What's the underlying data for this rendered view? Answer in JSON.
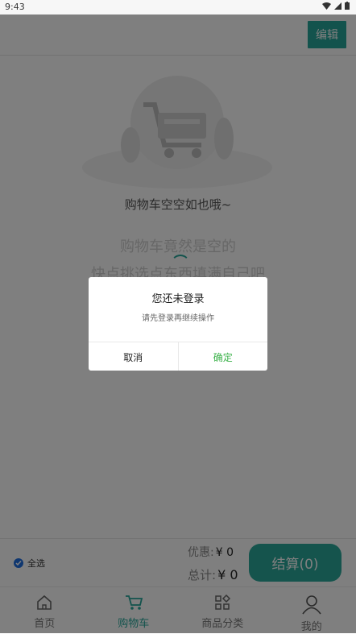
{
  "status_bar": {
    "time": "9:43"
  },
  "header": {
    "edit_label": "编辑"
  },
  "empty_state": {
    "title": "购物车空空如也哦~",
    "line1": "购物车竟然是空的",
    "line2": "快点挑选点东西填满自己吧"
  },
  "bottom_bar": {
    "select_all_label": "全选",
    "discount_label": "优惠:",
    "discount_value": "¥ 0",
    "total_label": "总计:",
    "total_value": "¥ 0",
    "checkout_label": "结算(0)"
  },
  "tabs": [
    {
      "label": "首页",
      "icon": "home-icon",
      "active": false
    },
    {
      "label": "购物车",
      "icon": "cart-icon",
      "active": true
    },
    {
      "label": "商品分类",
      "icon": "category-icon",
      "active": false
    },
    {
      "label": "我的",
      "icon": "user-icon",
      "active": false
    }
  ],
  "dialog": {
    "title": "您还未登录",
    "message": "请先登录再继续操作",
    "cancel_label": "取消",
    "confirm_label": "确定"
  },
  "colors": {
    "accent": "#27a79a",
    "confirm": "#3bb24a",
    "select": "#1e6fe0"
  }
}
